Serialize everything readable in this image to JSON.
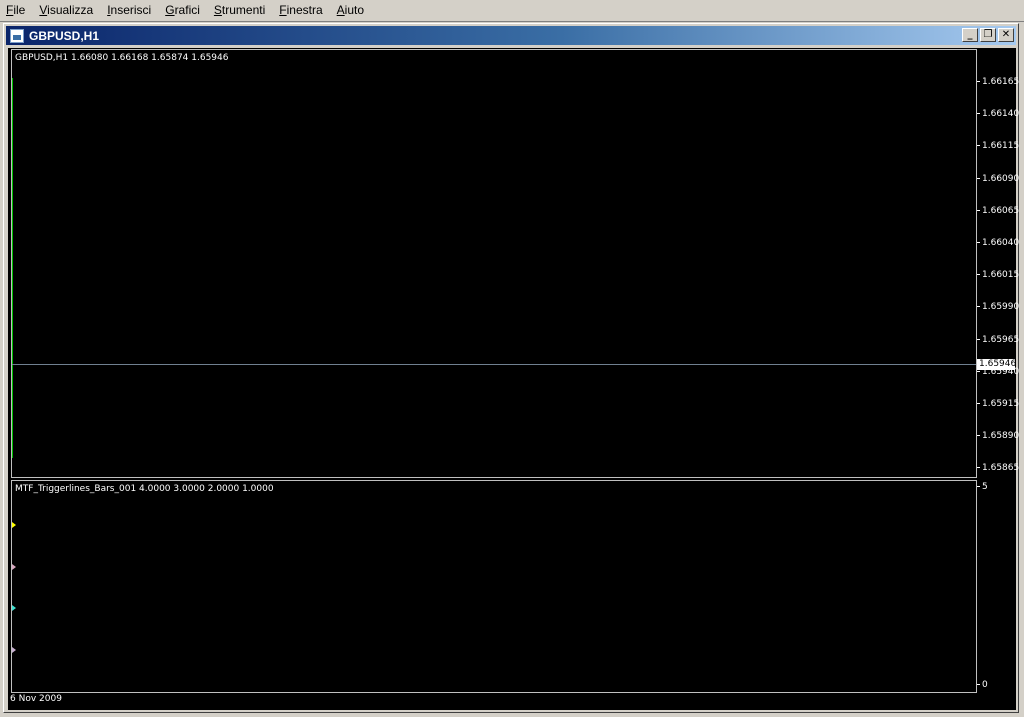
{
  "menu": [
    {
      "name": "menu-file",
      "first": "F",
      "rest": "ile"
    },
    {
      "name": "menu-visualizza",
      "first": "V",
      "rest": "isualizza"
    },
    {
      "name": "menu-inserisci",
      "first": "I",
      "rest": "nserisci"
    },
    {
      "name": "menu-grafici",
      "first": "G",
      "rest": "rafici"
    },
    {
      "name": "menu-strumenti",
      "first": "S",
      "rest": "trumenti"
    },
    {
      "name": "menu-finestra",
      "first": "F",
      "rest": "inestra"
    },
    {
      "name": "menu-aiuto",
      "first": "A",
      "rest": "iuto"
    }
  ],
  "window": {
    "title": "GBPUSD,H1",
    "icon": "chart-window-icon",
    "buttons": {
      "minimize": "_",
      "restore": "❐",
      "close": "✕"
    }
  },
  "main_chart": {
    "label": "GBPUSD,H1  1.66080 1.66168 1.65874 1.65946",
    "price_ticks": [
      "1.66165",
      "1.66140",
      "1.66115",
      "1.66090",
      "1.66065",
      "1.66040",
      "1.66015",
      "1.65990",
      "1.65965",
      "1.65940",
      "1.65915",
      "1.65890",
      "1.65865"
    ],
    "bid_price": "1.65946",
    "line_color": "#708090"
  },
  "indicator": {
    "label": "MTF_Triggerlines_Bars_001 4.0000 3.0000 2.0000 1.0000",
    "ticks": [
      "5",
      "0"
    ],
    "markers": [
      {
        "name": "marker-4",
        "value": 4,
        "color": "#ffff00"
      },
      {
        "name": "marker-3",
        "value": 3,
        "color": "#d8a8c0"
      },
      {
        "name": "marker-2",
        "value": 2,
        "color": "#40e0d0"
      },
      {
        "name": "marker-1",
        "value": 1,
        "color": "#c8b0d0"
      }
    ]
  },
  "time_axis": {
    "date_label": "6 Nov 2009"
  }
}
